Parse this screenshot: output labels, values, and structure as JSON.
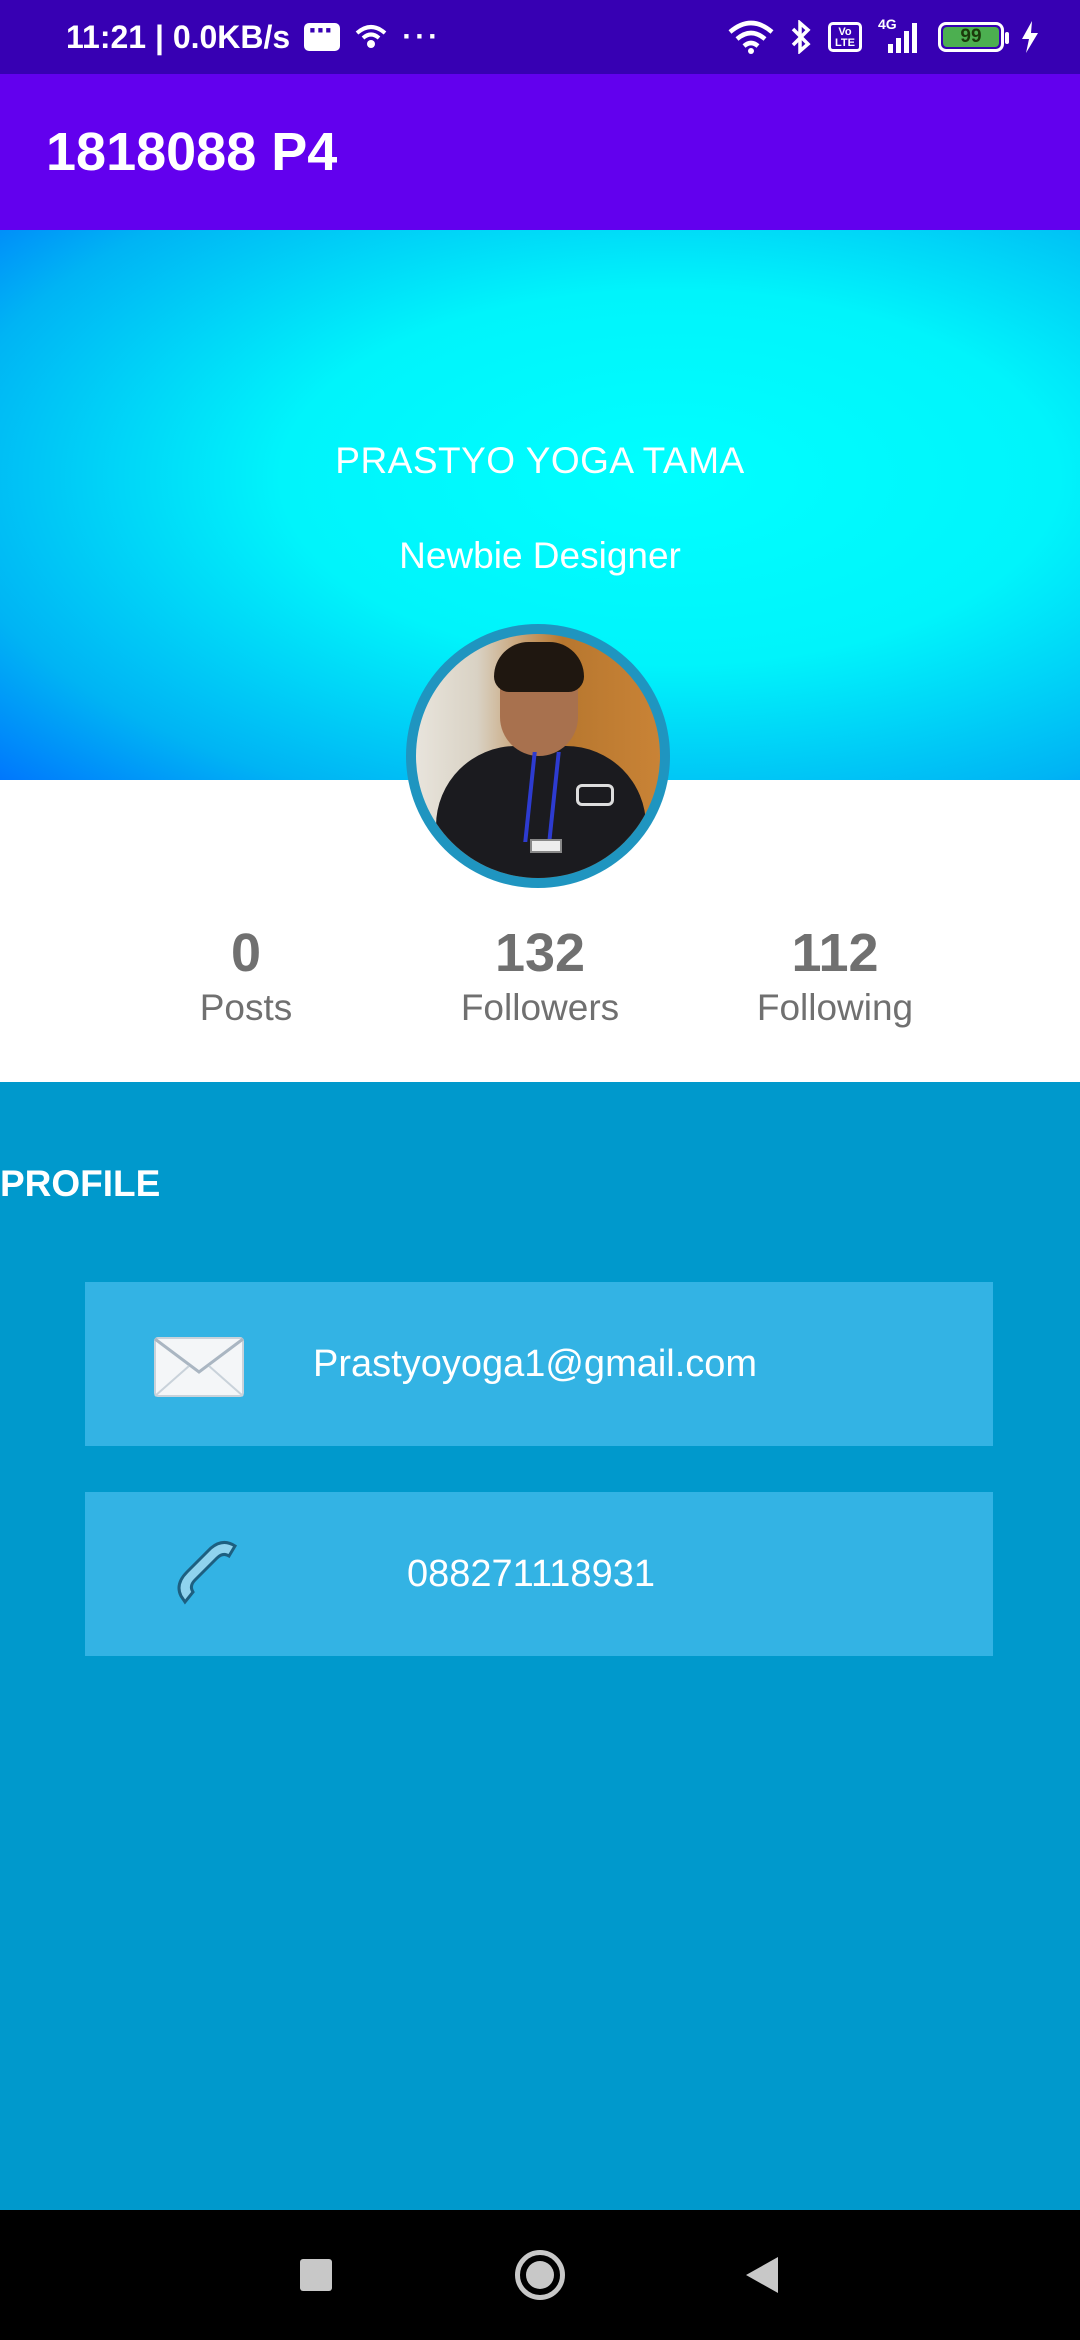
{
  "status_bar": {
    "time_speed": "11:21 | 0.0KB/s",
    "network_label": "4G",
    "volte_label": "Vo LTE",
    "battery_level": "99",
    "icons": [
      "message-icon",
      "hotspot-icon",
      "more-dots-icon",
      "wifi-icon",
      "bluetooth-icon",
      "volte-icon",
      "signal-icon",
      "battery-icon",
      "charging-icon"
    ]
  },
  "app_bar": {
    "title": "1818088 P4"
  },
  "header": {
    "name": "PRASTYO YOGA TAMA",
    "role": "Newbie Designer",
    "gradient_colors": [
      "#00ffff",
      "#00b4f4",
      "#0066ff"
    ]
  },
  "stats": [
    {
      "value": "0",
      "label": "Posts"
    },
    {
      "value": "132",
      "label": "Followers"
    },
    {
      "value": "112",
      "label": "Following"
    }
  ],
  "profile": {
    "section_title": "PROFILE",
    "email": {
      "icon": "envelope-icon",
      "value": "Prastyoyoga1@gmail.com"
    },
    "phone": {
      "icon": "telephone-icon",
      "value": "088271118931"
    }
  },
  "nav_bar": {
    "icons": [
      "recent-apps-icon",
      "home-icon",
      "back-icon"
    ]
  },
  "colors": {
    "status_bar": "#3700b3",
    "app_bar": "#6200ee",
    "background": "#0099cc",
    "card": "#33b3e4",
    "stat_text": "#707070"
  }
}
